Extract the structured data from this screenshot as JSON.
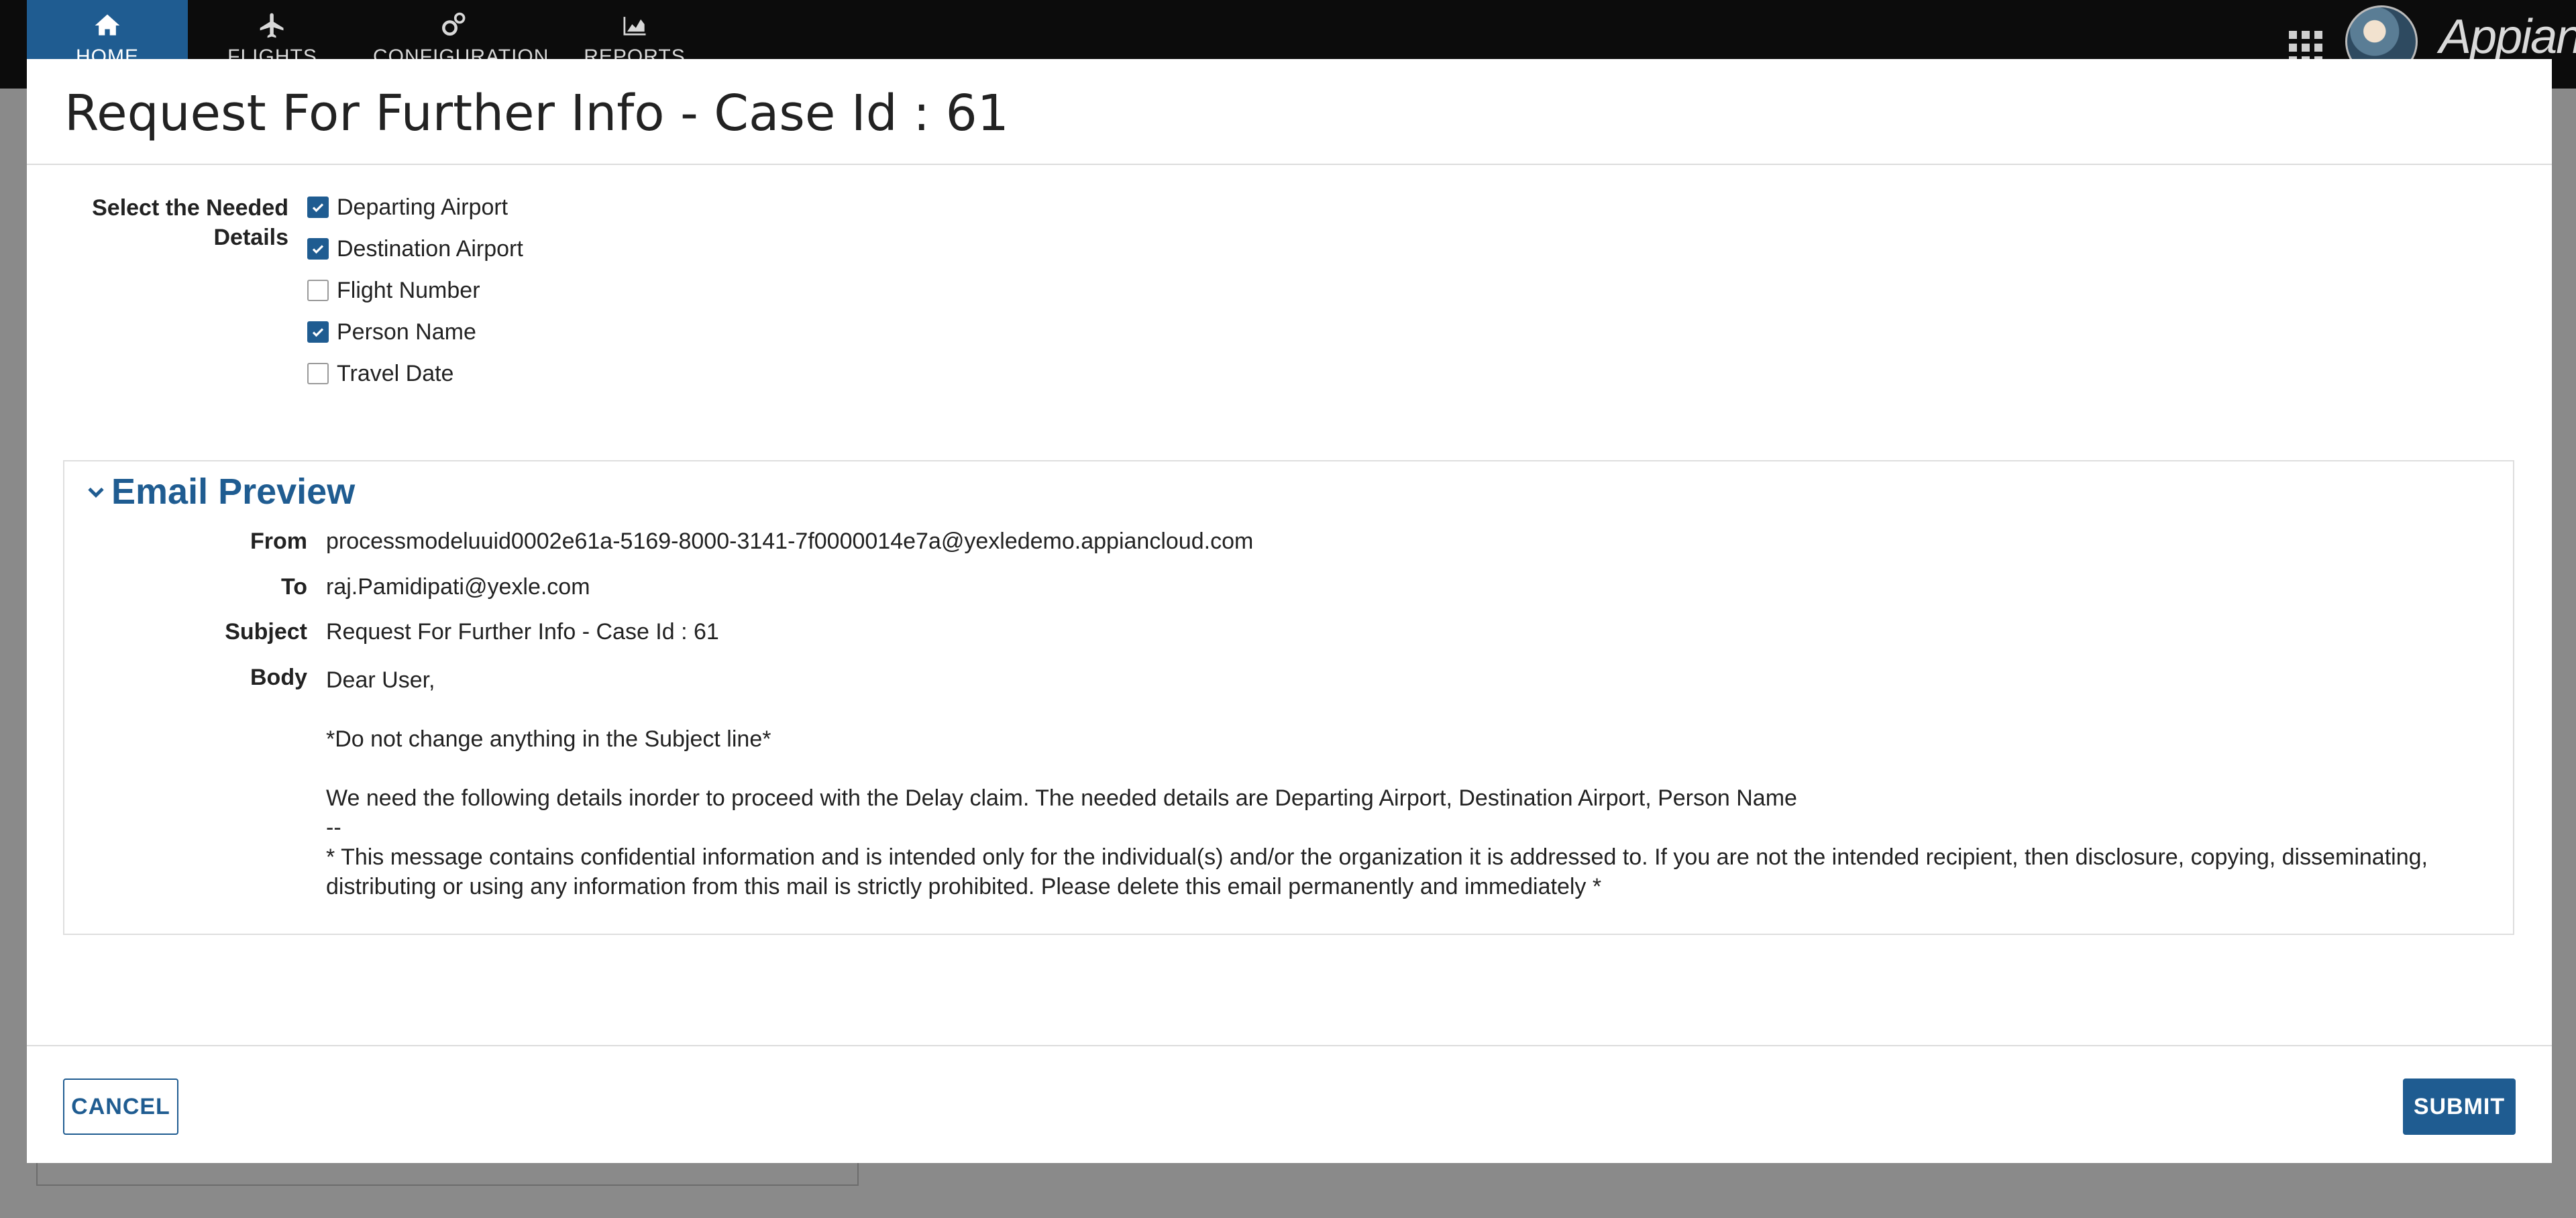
{
  "nav": {
    "tabs": [
      {
        "label": "HOME",
        "icon": "home-icon",
        "active": true
      },
      {
        "label": "FLIGHTS",
        "icon": "airplane-icon",
        "active": false
      },
      {
        "label": "CONFIGURATION",
        "icon": "gears-icon",
        "active": false
      },
      {
        "label": "REPORTS",
        "icon": "area-chart-icon",
        "active": false
      }
    ],
    "logo_text": "Appian"
  },
  "modal": {
    "title": "Request For Further Info - Case Id : 61",
    "needed_label": "Select the Needed Details",
    "checkboxes": [
      {
        "label": "Departing Airport",
        "checked": true
      },
      {
        "label": "Destination Airport",
        "checked": true
      },
      {
        "label": "Flight Number",
        "checked": false
      },
      {
        "label": "Person Name",
        "checked": true
      },
      {
        "label": "Travel Date",
        "checked": false
      }
    ]
  },
  "preview": {
    "title": "Email Preview",
    "from_label": "From",
    "from": "processmodeluuid0002e61a-5169-8000-3141-7f0000014e7a@yexledemo.appiancloud.com",
    "to_label": "To",
    "to": "raj.Pamidipati@yexle.com",
    "subject_label": "Subject",
    "subject": "Request For Further Info - Case Id : 61",
    "body_label": "Body",
    "body": {
      "greeting": "Dear User,",
      "note": "*Do not change anything in the Subject line*",
      "main": "We need the following details inorder to proceed with the Delay claim. The needed details are Departing Airport, Destination Airport, Person Name",
      "separator": "--",
      "disclaimer": "* This message contains confidential information and is intended only for the individual(s) and/or the organization it is addressed to. If you are not the intended recipient,  then disclosure, copying, disseminating, distributing or using any information from this mail is strictly prohibited. Please delete this email permanently and immediately *"
    }
  },
  "footer": {
    "cancel_label": "CANCEL",
    "submit_label": "SUBMIT"
  },
  "colors": {
    "accent": "#1f5c91",
    "topbar": "#0c0c0c",
    "overlay": "#8a8a8a"
  }
}
